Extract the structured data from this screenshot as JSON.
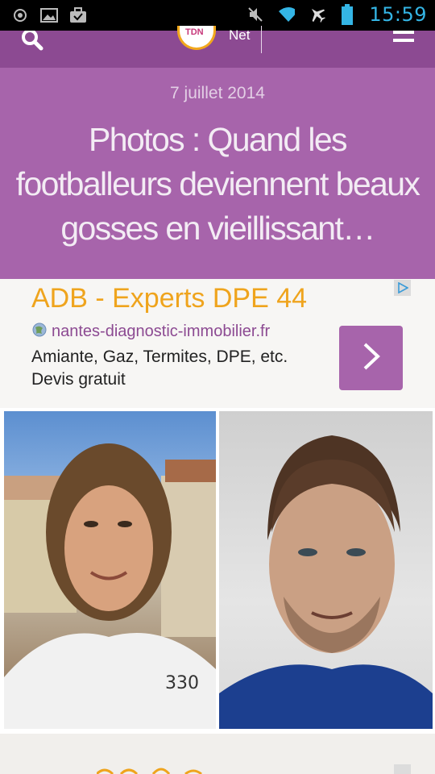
{
  "status_bar": {
    "time": "15:59",
    "icons": [
      "circle-icon",
      "image-icon",
      "briefcase-icon",
      "mute-icon",
      "wifi-icon",
      "airplane-icon",
      "battery-icon"
    ]
  },
  "header": {
    "logo_text": "TDN",
    "logo_net": "Net",
    "icons": [
      "search-icon",
      "menu-icon"
    ]
  },
  "article": {
    "date": "7 juillet 2014",
    "title": "Photos : Quand les footballeurs deviennent beaux gosses en vieillissant…"
  },
  "ad": {
    "title": "ADB - Experts DPE 44",
    "url": "nantes-diagnostic-immobilier.fr",
    "description": "Amiante, Gaz, Termites, DPE, etc. Devis gratuit",
    "icons": [
      "ad-choices-icon",
      "globe-icon",
      "chevron-right-icon"
    ]
  },
  "colors": {
    "header": "#8c4a92",
    "title_band": "#a764ab",
    "ad_title": "#efa41d",
    "ad_url": "#8c4a92",
    "status_time": "#34b5e5"
  }
}
